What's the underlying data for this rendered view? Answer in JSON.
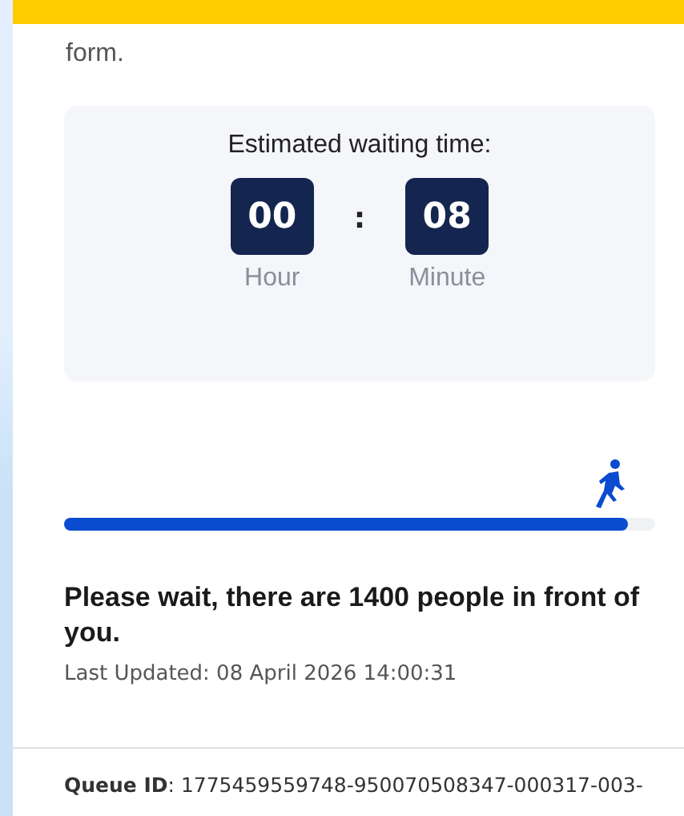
{
  "intro": "form.",
  "waiting": {
    "title": "Estimated waiting time:",
    "separator": ":",
    "units": [
      {
        "value": "00",
        "label": "Hour"
      },
      {
        "value": "08",
        "label": "Minute"
      }
    ]
  },
  "progress": {
    "level": 0.953
  },
  "message": "Please wait, there are 1400 people in front of you.",
  "last_updated": "Last Updated: 08 April 2026 14:00:31",
  "queue_id": "**Queue ID**: 1775459559748-950070508347-000317-003-"
}
